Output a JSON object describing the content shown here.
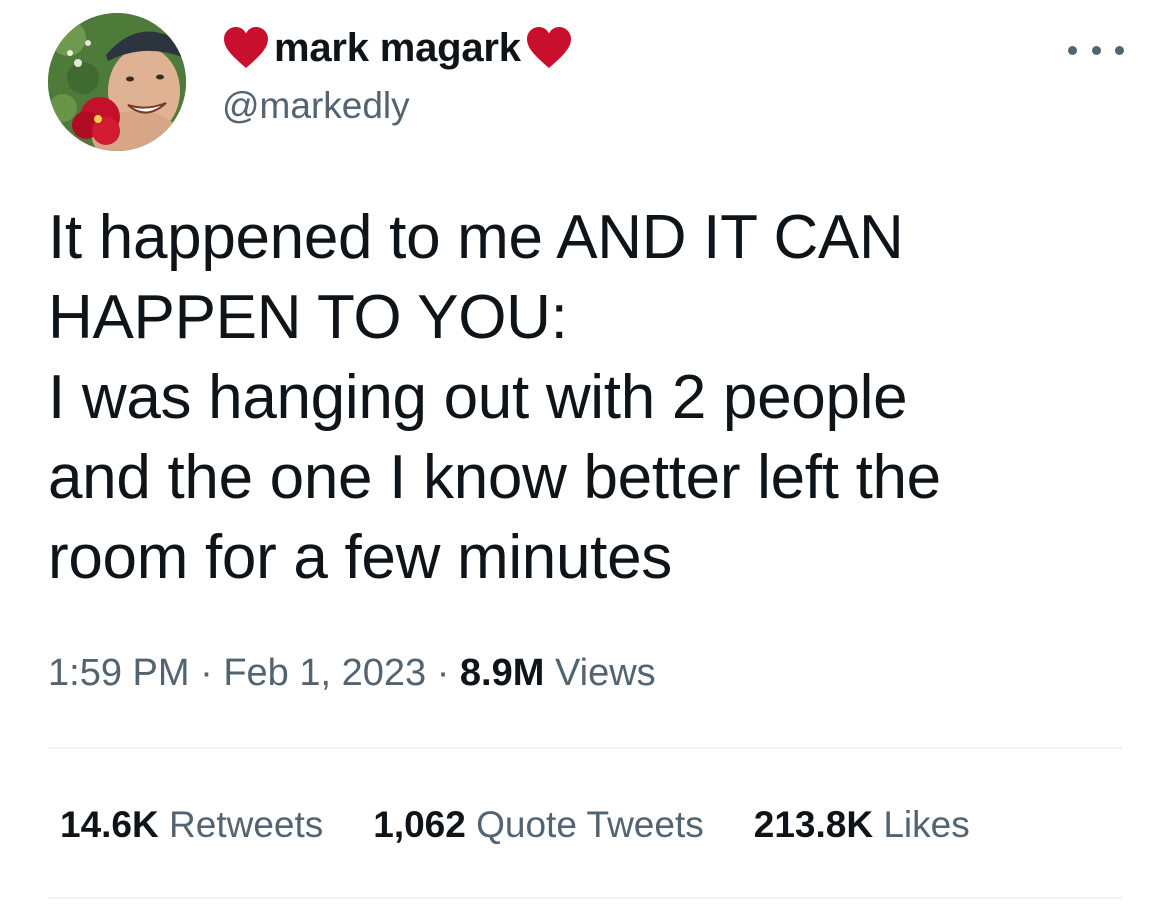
{
  "author": {
    "display_name": "mark magark",
    "handle": "@markedly",
    "heart_color": "#c8102e",
    "avatar": "profile-photo"
  },
  "more_icon": "more-horizontal-icon",
  "tweet": {
    "lines": [
      "It happened to me AND IT CAN",
      "HAPPEN TO YOU:",
      "I was hanging out with 2 people",
      "and the one I know better left the",
      "room for a few minutes"
    ]
  },
  "meta": {
    "time": "1:59 PM",
    "separator": "·",
    "date": "Feb 1, 2023",
    "views_count": "8.9M",
    "views_label": "Views"
  },
  "stats": {
    "retweets_count": "14.6K",
    "retweets_label": "Retweets",
    "quotes_count": "1,062",
    "quotes_label": "Quote Tweets",
    "likes_count": "213.8K",
    "likes_label": "Likes"
  },
  "colors": {
    "text": "#0f1419",
    "secondary": "#536471",
    "divider": "#eff3f4"
  }
}
